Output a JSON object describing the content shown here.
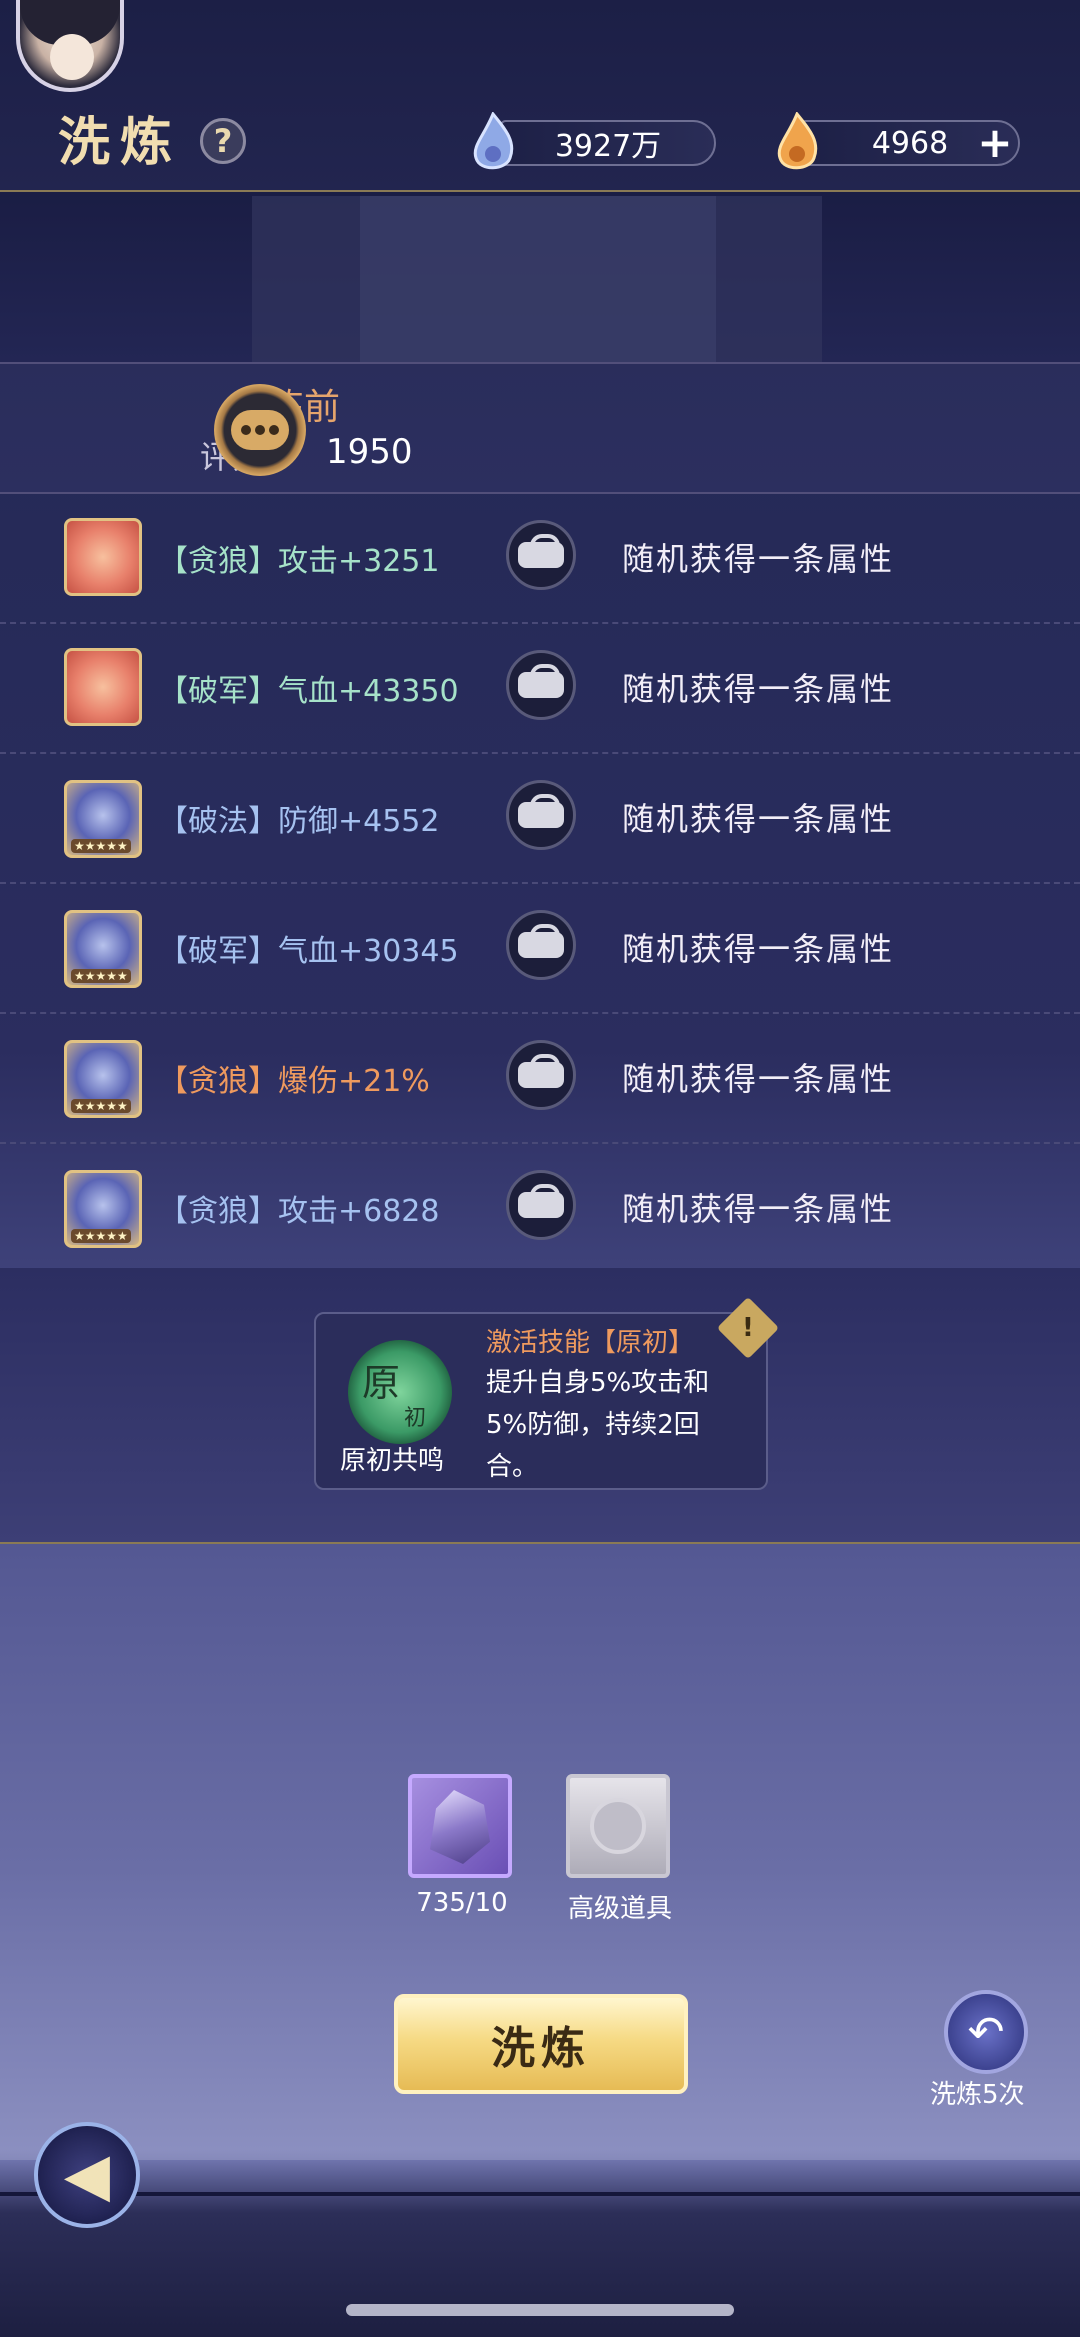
{
  "header": {
    "title": "洗炼",
    "help_icon": "?",
    "currency_silver": "3927万",
    "currency_gold": "4968",
    "plus_icon": "+"
  },
  "rating": {
    "pre_label": "炼前",
    "score_label": "评分：",
    "score_value": "1950"
  },
  "attributes": [
    {
      "tag": "【贪狼】攻击+3251",
      "result": "随机获得一条属性",
      "color": "green"
    },
    {
      "tag": "【破军】气血+43350",
      "result": "随机获得一条属性",
      "color": "green"
    },
    {
      "tag": "【破法】防御+4552",
      "result": "随机获得一条属性",
      "color": "blue"
    },
    {
      "tag": "【破军】气血+30345",
      "result": "随机获得一条属性",
      "color": "blue"
    },
    {
      "tag": "【贪狼】爆伤+21%",
      "result": "随机获得一条属性",
      "color": "orange"
    },
    {
      "tag": "【贪狼】攻击+6828",
      "result": "随机获得一条属性",
      "color": "blue"
    }
  ],
  "skill": {
    "badge_main": "原",
    "badge_sub": "初",
    "name": "原初共鸣",
    "title": "激活技能【原初】",
    "desc": "提升自身5%攻击和5%防御，持续2回合。",
    "warn_icon": "!"
  },
  "materials": [
    {
      "label": "735/10"
    },
    {
      "label": "高级道具"
    }
  ],
  "buttons": {
    "refine": "洗炼",
    "refine5": "洗炼5次"
  },
  "colors": {
    "accent_gold": "#f1ddb0",
    "green_text": "#a6e2c9",
    "blue_text": "#a6c2f0",
    "orange_text": "#ef9a5e"
  }
}
